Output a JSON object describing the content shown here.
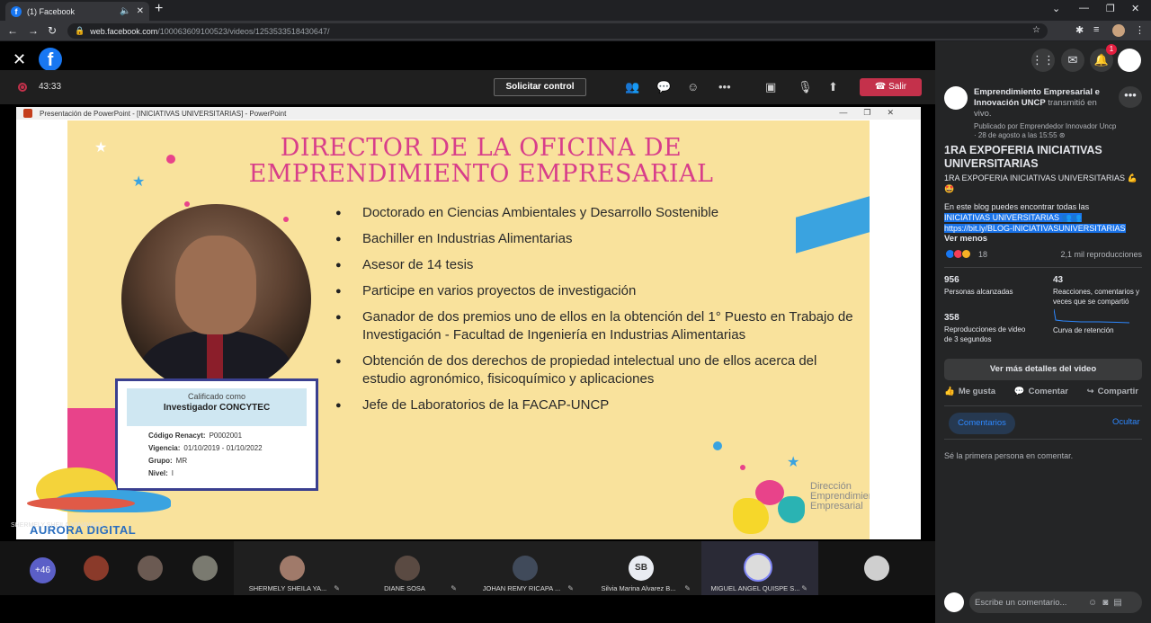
{
  "browser": {
    "tab_title": "(1) Facebook",
    "url_host": "web.facebook.com",
    "url_path": "/100063609100523/videos/1253533518430647/"
  },
  "meeting": {
    "timer": "43:33",
    "request_control": "Solicitar control",
    "leave": "Salir",
    "leave_color": "#c4314b"
  },
  "ppt": {
    "window_title": "Presentación de PowerPoint - [INICIATIVAS UNIVERSITARIAS] - PowerPoint"
  },
  "slide": {
    "heading_line1": "DIRECTOR DE LA OFICINA DE",
    "heading_line2": "EMPRENDIMIENTO EMPRESARIAL",
    "bullets": [
      "Doctorado en Ciencias Ambientales y Desarrollo Sostenible",
      "Bachiller en Industrias Alimentarias",
      "Asesor de 14 tesis",
      "Participe en varios proyectos de investigación",
      "Ganador de dos premios  uno de ellos en la obtención del 1° Puesto en Trabajo de Investigación - Facultad de Ingeniería en Industrias Alimentarias",
      "Obtención de dos derechos de propiedad intelectual uno de ellos acerca del estudio agronómico, fisicoquímico y aplicaciones",
      "Jefe de Laboratorios de la FACAP-UNCP"
    ],
    "card": {
      "line1": "Calificado como",
      "line2": "Investigador CONCYTEC",
      "codigo_label": "Código Renacyt:",
      "codigo_value": "P0002001",
      "vigencia_label": "Vigencia:",
      "vigencia_value": "01/10/2019 - 01/10/2022",
      "grupo_label": "Grupo:",
      "grupo_value": "MR",
      "nivel_label": "Nivel:",
      "nivel_value": "I"
    },
    "brand_line1": "Dirección",
    "brand_line2": "Emprendimiento",
    "brand_line3": "Empresarial",
    "aurora_text": "AURORA DIGITAL",
    "presenter_overlay": "SHERMELY SHEILA YANAYACO"
  },
  "participants": {
    "overflow": "+46",
    "tiles": [
      {
        "name": "SHERMELY SHEILA YA..."
      },
      {
        "name": "DIANE SOSA"
      },
      {
        "name": "JOHAN REMY RICAPA ..."
      },
      {
        "name": "Silvia Marina Alvarez B...",
        "initials": "SB"
      },
      {
        "name": "MIGUEL ANGEL QUISPE S..."
      }
    ]
  },
  "panel": {
    "notif_count": "1",
    "page_name": "Emprendimiento Empresarial e Innovación UNCP",
    "streamed_text": "transmitió en vivo.",
    "publisher": "Publicado por Emprendedor Innovador Uncp",
    "date": "28 de agosto a las 15:55",
    "video_title": "1RA EXPOFERIA INICIATIVAS UNIVERSITARIAS",
    "desc_line1": "1RA EXPOFERIA INICIATIVAS UNIVERSITARIAS 💪🤩",
    "desc_line2": "En este blog puedes encontrar todas las",
    "desc_highlight1": "INICIATIVAS UNIVERSITARIAS 👥👥",
    "desc_link": "https://bit.ly/BLOG-INICIATIVASUNIVERSITARIAS",
    "see_less": "Ver menos",
    "reaction_count": "18",
    "views": "2,1 mil reproducciones",
    "stats": [
      {
        "value": "956",
        "label": "Personas alcanzadas"
      },
      {
        "value": "43",
        "label": "Reacciones, comentarios y veces que se compartió"
      },
      {
        "value": "358",
        "label": "Reproducciones de video de 3 segundos"
      },
      {
        "value": "",
        "label": "Curva de retención"
      }
    ],
    "details_button": "Ver más detalles del video",
    "like": "Me gusta",
    "comment": "Comentar",
    "share": "Compartir",
    "comments_tab": "Comentarios",
    "hide": "Ocultar",
    "first_comment": "Sé la primera persona en comentar.",
    "composer_placeholder": "Escribe un comentario..."
  }
}
